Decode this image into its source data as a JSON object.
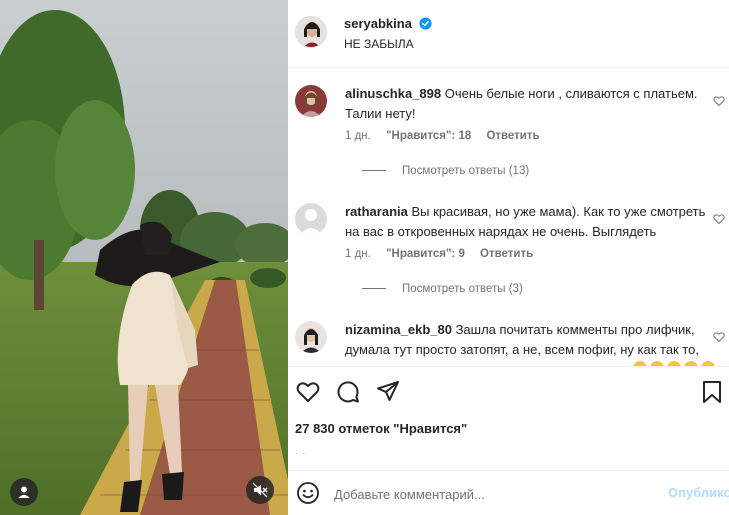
{
  "post": {
    "author": "seryabkina",
    "caption": "НЕ ЗАБЫЛА"
  },
  "comments": [
    {
      "username": "alinuschka_898",
      "text": "Очень белые ноги , сливаются с платьем. Талии нету!",
      "time": "1 дн.",
      "likes": "\"Нравится\": 18",
      "reply": "Ответить",
      "view_replies": "Посмотреть ответы (13)"
    },
    {
      "username": "ratharania",
      "text": "Вы красивая, но уже мама). Как то уже смотреть на вас в откровенных нарядах не очень. Выглядеть",
      "time": "1 дн.",
      "likes": "\"Нравится\": 9",
      "reply": "Ответить",
      "view_replies": "Посмотреть ответы (3)"
    },
    {
      "username": "nizamina_ekb_80",
      "text": "Зашла почитать комменты про лифчик, думала тут просто затопят, а не, всем пофиг, ну как так то,"
    }
  ],
  "engagement": {
    "likes_count": "27 830 отметок \"Нравится\"",
    "date_placeholder": ". ."
  },
  "composer": {
    "placeholder": "Добавьте комментарий...",
    "publish_label": "Опубликовать"
  },
  "colors": {
    "verified": "#0095f6",
    "publish_disabled": "#b3dbff",
    "secondary_text": "#737373"
  },
  "icons": {
    "like": "heart-icon",
    "comment": "comment-icon",
    "share": "send-icon",
    "save": "bookmark-icon",
    "emoji": "smiley-icon",
    "mute": "speaker-muted-icon",
    "tagged": "user-icon"
  }
}
